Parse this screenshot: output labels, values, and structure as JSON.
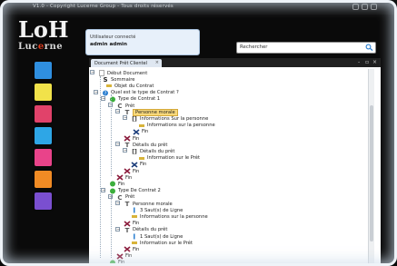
{
  "window": {
    "title": "V1.0 - Copyright Lucerne Group - Tous droits réservés"
  },
  "logo": {
    "main": "LoH",
    "sub_prefix": "Luc",
    "sub_accent": "e",
    "sub_suffix": "rne"
  },
  "user": {
    "label": "Utilisateur connecté",
    "name": "admin admin"
  },
  "search": {
    "placeholder": "Rechercher"
  },
  "sidebar": {
    "items": [
      {
        "icon": "window-icon",
        "color": "#2f8fe0"
      },
      {
        "icon": "document-icon",
        "color": "#f1e24a"
      },
      {
        "icon": "list-icon",
        "color": "#e1426a"
      },
      {
        "icon": "tag-icon",
        "color": "#2ea6e6"
      },
      {
        "icon": "users-icon",
        "color": "#e9438a"
      },
      {
        "icon": "tools-icon",
        "color": "#f18b24"
      },
      {
        "icon": "gear-icon",
        "color": "#7a4fd0"
      }
    ]
  },
  "tab": {
    "label": "Document Prêt Clientel",
    "close": "×"
  },
  "tree": [
    {
      "label": "Début Document",
      "icon": "doc-icon",
      "color": "#888888"
    },
    {
      "label": "Sommaire",
      "icon": "s-icon",
      "color": "#222222"
    },
    {
      "label": "Objet du Contrat",
      "icon": "bar-icon",
      "color": "#d8b43a"
    },
    {
      "label": "Quel est le type de Contrat ?",
      "icon": "question-icon",
      "color": "#2b7fd0"
    },
    {
      "label": "Type de Contrat 1",
      "icon": "green-circle-icon",
      "color": "#3cae3c"
    },
    {
      "label": "Prêt",
      "icon": "c-icon",
      "color": "#555555"
    },
    {
      "label": "Personne morale",
      "icon": "t-icon",
      "color": "#555555"
    },
    {
      "label": "Informations Sur la personne",
      "icon": "loop-icon",
      "color": "#333333"
    },
    {
      "label": "Informations sur la personne",
      "icon": "bar-icon",
      "color": "#d8b43a"
    },
    {
      "label": "Fin",
      "icon": "x-icon",
      "color": "#1a3c7a"
    },
    {
      "label": "Fin",
      "icon": "x-icon",
      "color": "#8a1a3a"
    },
    {
      "label": "Détails du prêt",
      "icon": "t-icon",
      "color": "#555555"
    },
    {
      "label": "Détails du prêt",
      "icon": "loop-icon",
      "color": "#333333"
    },
    {
      "label": "Information sur le Prêt",
      "icon": "bar-icon",
      "color": "#d8b43a"
    },
    {
      "label": "Fin",
      "icon": "x-icon",
      "color": "#1a3c7a"
    },
    {
      "label": "Fin",
      "icon": "x-icon",
      "color": "#8a1a3a"
    },
    {
      "label": "Fin",
      "icon": "x-icon",
      "color": "#8a1a3a"
    },
    {
      "label": "Fin",
      "icon": "green-circle-icon",
      "color": "#3cae3c"
    },
    {
      "label": "Type De Contrat 2",
      "icon": "green-circle-icon",
      "color": "#3cae3c"
    },
    {
      "label": "Prêt",
      "icon": "c-icon",
      "color": "#555555"
    },
    {
      "label": "Personne morale",
      "icon": "t-icon",
      "color": "#555555"
    },
    {
      "label": "3 Saut(s) de Ligne",
      "icon": "line-icon",
      "color": "#2b7fd0"
    },
    {
      "label": "Informations sur la personne",
      "icon": "bar-icon",
      "color": "#d8b43a"
    },
    {
      "label": "Fin",
      "icon": "x-icon",
      "color": "#8a1a3a"
    },
    {
      "label": "Détails du prêt",
      "icon": "t-icon",
      "color": "#555555"
    },
    {
      "label": "1 Saut(s) de Ligne",
      "icon": "line-icon",
      "color": "#2b7fd0"
    },
    {
      "label": "Information sur le Prêt",
      "icon": "bar-icon",
      "color": "#d8b43a"
    },
    {
      "label": "Fin",
      "icon": "x-icon",
      "color": "#8a1a3a"
    },
    {
      "label": "Fin",
      "icon": "x-icon",
      "color": "#8a1a3a"
    },
    {
      "label": "Fin",
      "icon": "green-circle-icon",
      "color": "#3cae3c"
    }
  ],
  "highlight_label": "Personne morale"
}
